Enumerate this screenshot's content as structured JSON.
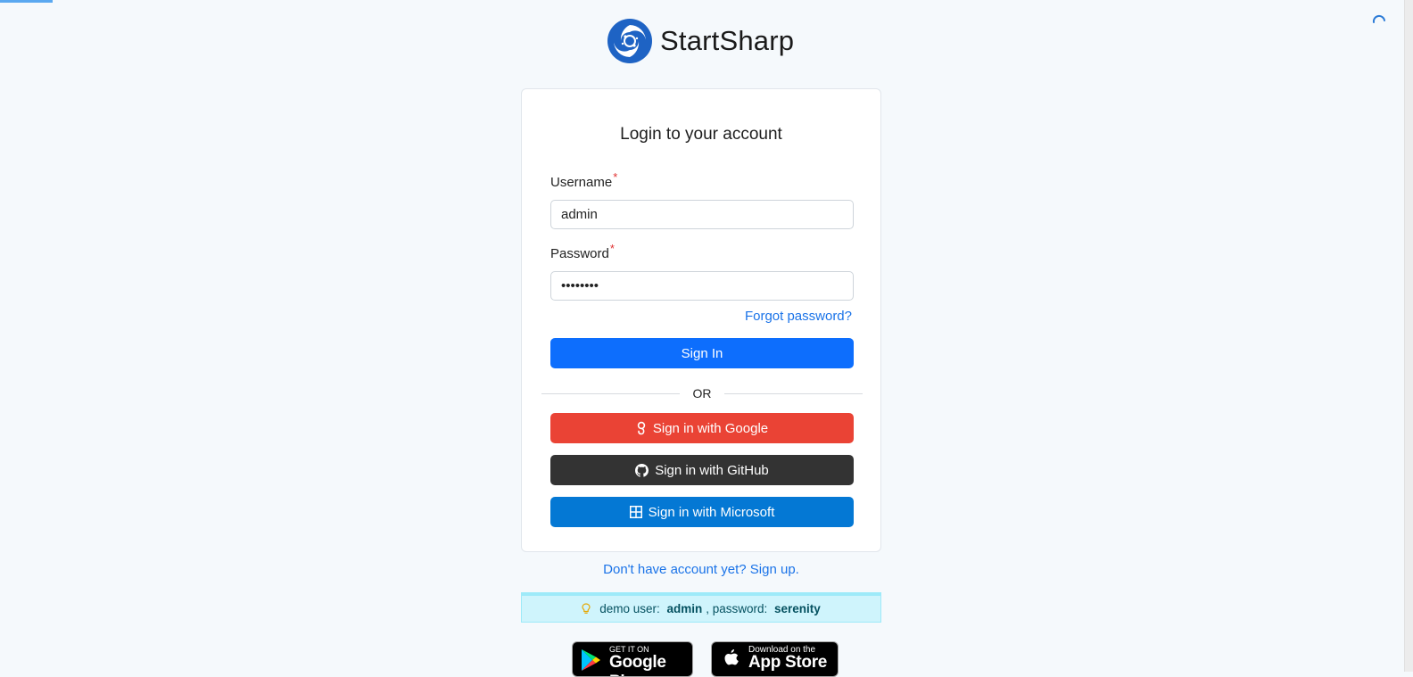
{
  "brand": {
    "name": "StartSharp"
  },
  "login": {
    "title": "Login to your account",
    "username": {
      "label": "Username",
      "required_mark": "*",
      "value": "admin"
    },
    "password": {
      "label": "Password",
      "required_mark": "*",
      "value": "serenity"
    },
    "forgot_label": "Forgot password?",
    "signin_label": "Sign In",
    "or_label": "OR",
    "google_label": "Sign in with Google",
    "github_label": "Sign in with GitHub",
    "microsoft_label": "Sign in with Microsoft"
  },
  "signup_label": "Don't have account yet? Sign up.",
  "demo": {
    "prefix": "demo user: ",
    "user": "admin",
    "separator": ", password: ",
    "password": "serenity"
  },
  "stores": {
    "google": {
      "small": "GET IT ON",
      "big": "Google Play"
    },
    "apple": {
      "small": "Download on the",
      "big": "App Store"
    }
  },
  "colors": {
    "primary": "#0d6efd",
    "google": "#ea4335",
    "github": "#333333",
    "microsoft": "#0478d4",
    "link": "#1a73e8",
    "info_bg": "#cff4fc"
  },
  "icons": [
    "startsharp-logo-icon",
    "loading-spinner-icon",
    "google-icon",
    "github-icon",
    "microsoft-icon",
    "lightbulb-icon",
    "google-play-icon",
    "apple-icon"
  ]
}
